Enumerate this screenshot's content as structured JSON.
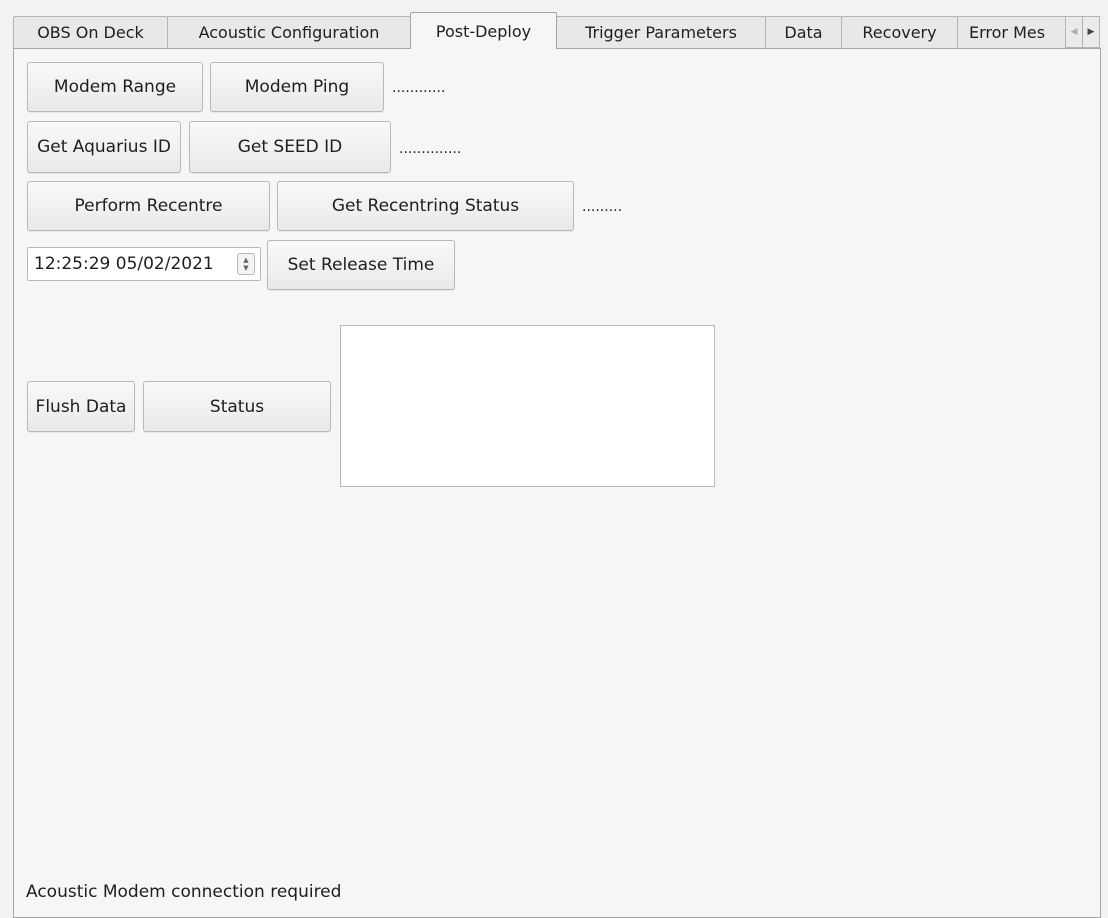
{
  "tabs": [
    {
      "label": "OBS On Deck",
      "active": false
    },
    {
      "label": "Acoustic Configuration",
      "active": false
    },
    {
      "label": "Post-Deploy",
      "active": true
    },
    {
      "label": "Trigger Parameters",
      "active": false
    },
    {
      "label": "Data",
      "active": false
    },
    {
      "label": "Recovery",
      "active": false
    },
    {
      "label": "Error Mes",
      "active": false
    }
  ],
  "tab_scroll": {
    "left_icon": "arrow-left-icon",
    "right_icon": "arrow-right-icon",
    "left_glyph": "◀",
    "right_glyph": "▶"
  },
  "modem": {
    "range_label": "Modem Range",
    "ping_label": "Modem Ping",
    "result": "............"
  },
  "ids": {
    "aquarius_label": "Get Aquarius ID",
    "seed_label": "Get SEED ID",
    "result": ".............."
  },
  "recentre": {
    "perform_label": "Perform Recentre",
    "status_label": "Get Recentring Status",
    "result": "........."
  },
  "release": {
    "datetime_value": "12:25:29 05/02/2021",
    "set_label": "Set Release Time",
    "spin_up": "▲",
    "spin_down": "▼"
  },
  "data_actions": {
    "flush_label": "Flush Data",
    "status_label": "Status",
    "output_text": ""
  },
  "status_bar": {
    "message": "Acoustic Modem connection required"
  },
  "colors": {
    "window_bg": "#f2f2f2",
    "panel_bg": "#f6f6f6",
    "border": "#b8b8b8"
  }
}
